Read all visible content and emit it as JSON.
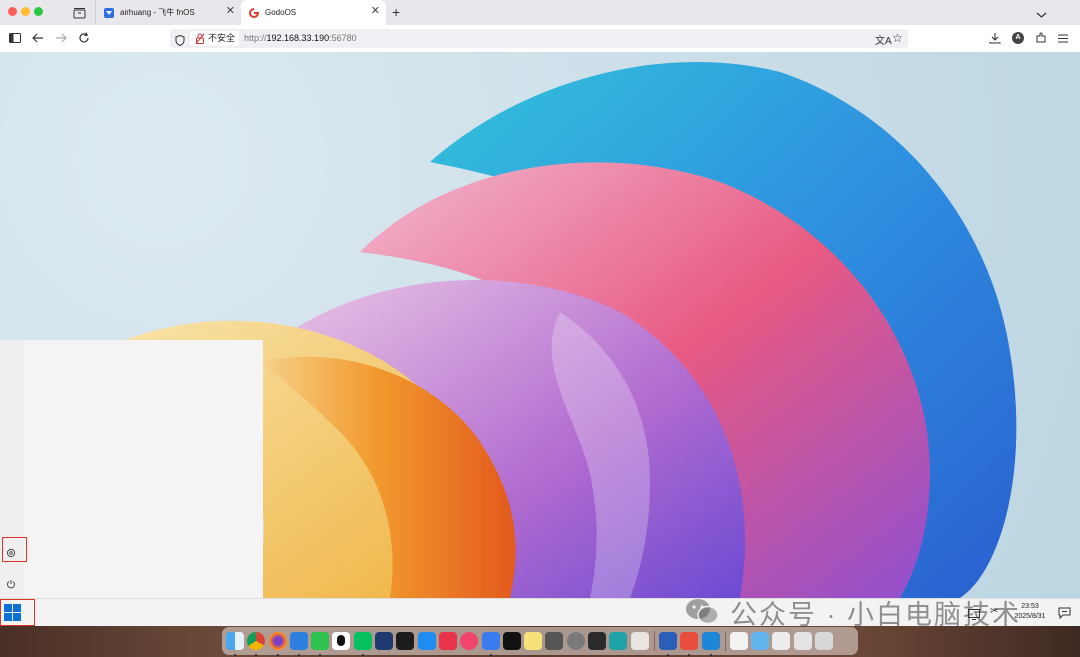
{
  "tabs": [
    {
      "title": "airhuang - 飞牛 fnOS",
      "active": false
    },
    {
      "title": "GodoOS",
      "active": true
    }
  ],
  "address_bar": {
    "security_label": "不安全",
    "url_prefix": "http://",
    "url_host": "192.168.33.190",
    "url_port": ":56780"
  },
  "taskbar": {
    "clock_time": "23:53",
    "clock_date": "2025/8/31"
  },
  "watermark": "公众号 · 小白电脑技术",
  "dock_icons": [
    "finder-icon",
    "chrome-icon",
    "firefox-icon",
    "windows-app-icon",
    "wechat-icon",
    "qq-icon",
    "wechat-work-icon",
    "downloader-icon",
    "activity-monitor-icon",
    "feishu-icon",
    "app-red-icon",
    "app-pink-icon",
    "baidu-netdisk-icon",
    "terminal-icon",
    "notes-icon",
    "calculator-icon",
    "system-settings-icon",
    "game-controller-icon",
    "app-teal-icon",
    "iphone-mirror-icon",
    "word-icon",
    "xmind-icon",
    "vscode-icon",
    "documents-folder-icon",
    "folder-icon",
    "mail-folder-icon",
    "downloads-folder-icon",
    "trash-icon"
  ],
  "colors": {
    "red_highlight": "#e0322a",
    "windows_blue": "#0a6fd6"
  }
}
